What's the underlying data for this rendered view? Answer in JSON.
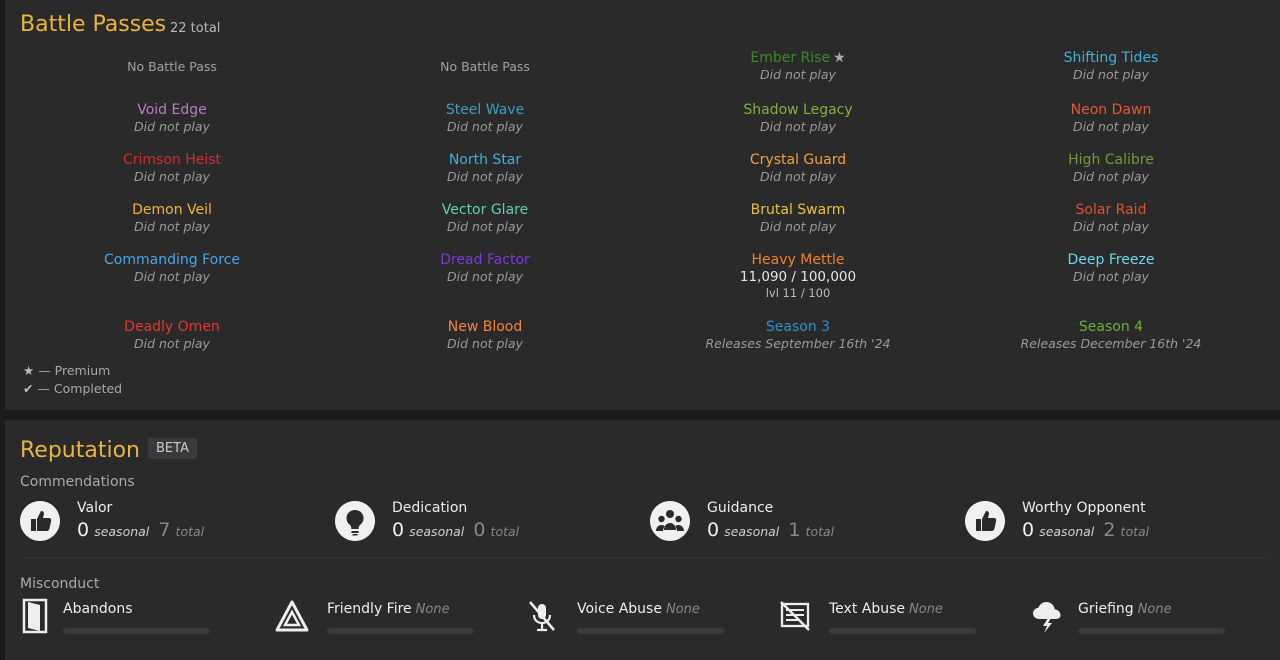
{
  "battle_passes": {
    "title": "Battle Passes",
    "total": "22 total",
    "cells": [
      {
        "name": "No Battle Pass",
        "sub": "",
        "color": "#a0a0a0",
        "kind": "none"
      },
      {
        "name": "No Battle Pass",
        "sub": "",
        "color": "#a0a0a0",
        "kind": "none"
      },
      {
        "name": "Ember Rise",
        "sub": "Did not play",
        "color": "#3a8a2c",
        "kind": "premium",
        "star": "★"
      },
      {
        "name": "Shifting Tides",
        "sub": "Did not play",
        "color": "#3fb0d8",
        "kind": "normal"
      },
      {
        "name": "Void Edge",
        "sub": "Did not play",
        "color": "#b77fc0",
        "kind": "normal"
      },
      {
        "name": "Steel Wave",
        "sub": "Did not play",
        "color": "#3f9cc4",
        "kind": "normal"
      },
      {
        "name": "Shadow Legacy",
        "sub": "Did not play",
        "color": "#7fb33a",
        "kind": "normal"
      },
      {
        "name": "Neon Dawn",
        "sub": "Did not play",
        "color": "#e1583a",
        "kind": "normal"
      },
      {
        "name": "Crimson Heist",
        "sub": "Did not play",
        "color": "#d42d2d",
        "kind": "normal"
      },
      {
        "name": "North Star",
        "sub": "Did not play",
        "color": "#3fb0d8",
        "kind": "normal"
      },
      {
        "name": "Crystal Guard",
        "sub": "Did not play",
        "color": "#f0a03a",
        "kind": "normal"
      },
      {
        "name": "High Calibre",
        "sub": "Did not play",
        "color": "#6d9a3a",
        "kind": "normal"
      },
      {
        "name": "Demon Veil",
        "sub": "Did not play",
        "color": "#f0b23a",
        "kind": "normal"
      },
      {
        "name": "Vector Glare",
        "sub": "Did not play",
        "color": "#5fd0b8",
        "kind": "normal"
      },
      {
        "name": "Brutal Swarm",
        "sub": "Did not play",
        "color": "#e6c33a",
        "kind": "normal"
      },
      {
        "name": "Solar Raid",
        "sub": "Did not play",
        "color": "#e0502e",
        "kind": "normal"
      },
      {
        "name": "Commanding Force",
        "sub": "Did not play",
        "color": "#4aa6ea",
        "kind": "normal"
      },
      {
        "name": "Dread Factor",
        "sub": "Did not play",
        "color": "#7a3ad6",
        "kind": "normal"
      },
      {
        "name": "Heavy Mettle",
        "sub": "",
        "color": "#f0802a",
        "kind": "progress",
        "progress": "11,090 / 100,000",
        "level": "lvl 11 / 100"
      },
      {
        "name": "Deep Freeze",
        "sub": "Did not play",
        "color": "#6ed6ea",
        "kind": "normal"
      },
      {
        "name": "Deadly Omen",
        "sub": "Did not play",
        "color": "#e03a2e",
        "kind": "normal"
      },
      {
        "name": "New Blood",
        "sub": "Did not play",
        "color": "#f0843a",
        "kind": "normal"
      },
      {
        "name": "Season 3",
        "sub": "Releases September 16th '24",
        "color": "#2f8fcf",
        "kind": "normal"
      },
      {
        "name": "Season 4",
        "sub": "Releases December 16th '24",
        "color": "#6ab03a",
        "kind": "normal"
      }
    ],
    "legend": [
      {
        "glyph": "★",
        "text": " — Premium"
      },
      {
        "glyph": "✔",
        "text": " — Completed"
      }
    ]
  },
  "reputation": {
    "title": "Reputation",
    "badge": "BETA",
    "commendations_label": "Commendations",
    "commendations": [
      {
        "name": "Valor",
        "seasonal": "0",
        "seasonal_label": "seasonal",
        "total": "7",
        "total_label": "total",
        "icon": "thumbs-up-icon"
      },
      {
        "name": "Dedication",
        "seasonal": "0",
        "seasonal_label": "seasonal",
        "total": "0",
        "total_label": "total",
        "icon": "lightbulb-icon"
      },
      {
        "name": "Guidance",
        "seasonal": "0",
        "seasonal_label": "seasonal",
        "total": "1",
        "total_label": "total",
        "icon": "group-icon"
      },
      {
        "name": "Worthy Opponent",
        "seasonal": "0",
        "seasonal_label": "seasonal",
        "total": "2",
        "total_label": "total",
        "icon": "thumbs-up-icon"
      }
    ],
    "misconduct_label": "Misconduct",
    "misconduct": [
      {
        "name": "Abandons",
        "value": "",
        "icon": "door-icon"
      },
      {
        "name": "Friendly Fire",
        "value": "None",
        "icon": "triangle-icon"
      },
      {
        "name": "Voice Abuse",
        "value": "None",
        "icon": "muted-mic-icon"
      },
      {
        "name": "Text Abuse",
        "value": "None",
        "icon": "crossed-text-icon"
      },
      {
        "name": "Griefing",
        "value": "None",
        "icon": "storm-cloud-icon"
      }
    ]
  }
}
